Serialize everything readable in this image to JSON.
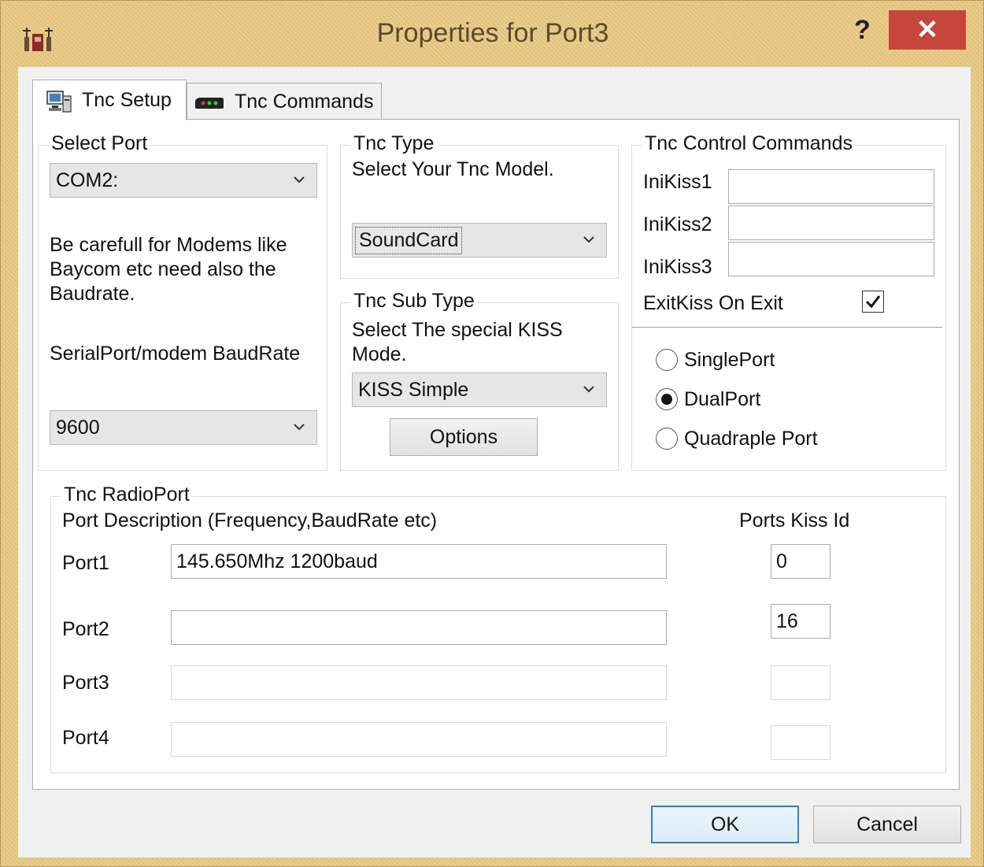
{
  "window": {
    "title": "Properties for Port3",
    "help_label": "?",
    "close_label": "✕"
  },
  "tabs": [
    {
      "label": "Tnc Setup",
      "active": true
    },
    {
      "label": "Tnc Commands",
      "active": false
    }
  ],
  "select_port": {
    "legend": "Select Port",
    "port_value": "COM2:",
    "warning_line1": "Be carefull for Modems like",
    "warning_line2": "Baycom etc need also the",
    "warning_line3": "Baudrate.",
    "baud_label": "SerialPort/modem BaudRate",
    "baud_value": "9600"
  },
  "tnc_type": {
    "legend": "Tnc Type",
    "instruction": "Select Your Tnc Model.",
    "model_value": "SoundCard"
  },
  "tnc_sub_type": {
    "legend": "Tnc Sub Type",
    "instruction_line1": "Select The special KISS",
    "instruction_line2": "Mode.",
    "mode_value": "KISS Simple",
    "options_button": "Options"
  },
  "tnc_control": {
    "legend": "Tnc Control Commands",
    "inikiss1_label": "IniKiss1",
    "inikiss1_value": "",
    "inikiss2_label": "IniKiss2",
    "inikiss2_value": "",
    "inikiss3_label": "IniKiss3",
    "inikiss3_value": "",
    "exitkiss_label": "ExitKiss On Exit",
    "exitkiss_checked": true,
    "radio_options": [
      "SinglePort",
      "DualPort",
      "Quadraple Port"
    ],
    "radio_selected": "DualPort"
  },
  "radio_port": {
    "legend": "Tnc RadioPort",
    "description_header": "Port Description (Frequency,BaudRate etc)",
    "kiss_id_header": "Ports Kiss Id",
    "ports": [
      {
        "label": "Port1",
        "description": "145.650Mhz 1200baud",
        "kiss_id": "0",
        "enabled": true
      },
      {
        "label": "Port2",
        "description": "",
        "kiss_id": "16",
        "enabled": true
      },
      {
        "label": "Port3",
        "description": "",
        "kiss_id": "",
        "enabled": false
      },
      {
        "label": "Port4",
        "description": "",
        "kiss_id": "",
        "enabled": false
      }
    ]
  },
  "footer": {
    "ok_label": "OK",
    "cancel_label": "Cancel"
  }
}
